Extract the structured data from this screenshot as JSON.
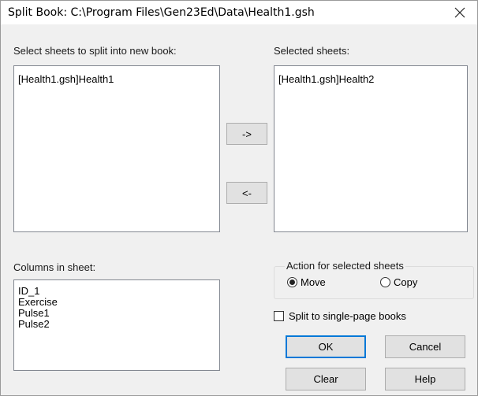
{
  "window": {
    "title": "Split Book: C:\\Program Files\\Gen23Ed\\Data\\Health1.gsh",
    "close_icon": "close-icon"
  },
  "left_list": {
    "label": "Select sheets to split into new book:",
    "items": [
      "[Health1.gsh]Health1"
    ]
  },
  "right_list": {
    "label": "Selected sheets:",
    "items": [
      "[Health1.gsh]Health2"
    ]
  },
  "move_buttons": {
    "add_label": "->",
    "remove_label": "<-"
  },
  "columns": {
    "label": "Columns in sheet:",
    "items": [
      "ID_1",
      "Exercise",
      "Pulse1",
      "Pulse2"
    ]
  },
  "action": {
    "label": "Action for selected sheets",
    "options": [
      {
        "label": "Move",
        "selected": true
      },
      {
        "label": "Copy",
        "selected": false
      }
    ]
  },
  "split_single": {
    "label": "Split to single-page books",
    "checked": false
  },
  "buttons": {
    "ok": "OK",
    "cancel": "Cancel",
    "clear": "Clear",
    "help": "Help"
  }
}
